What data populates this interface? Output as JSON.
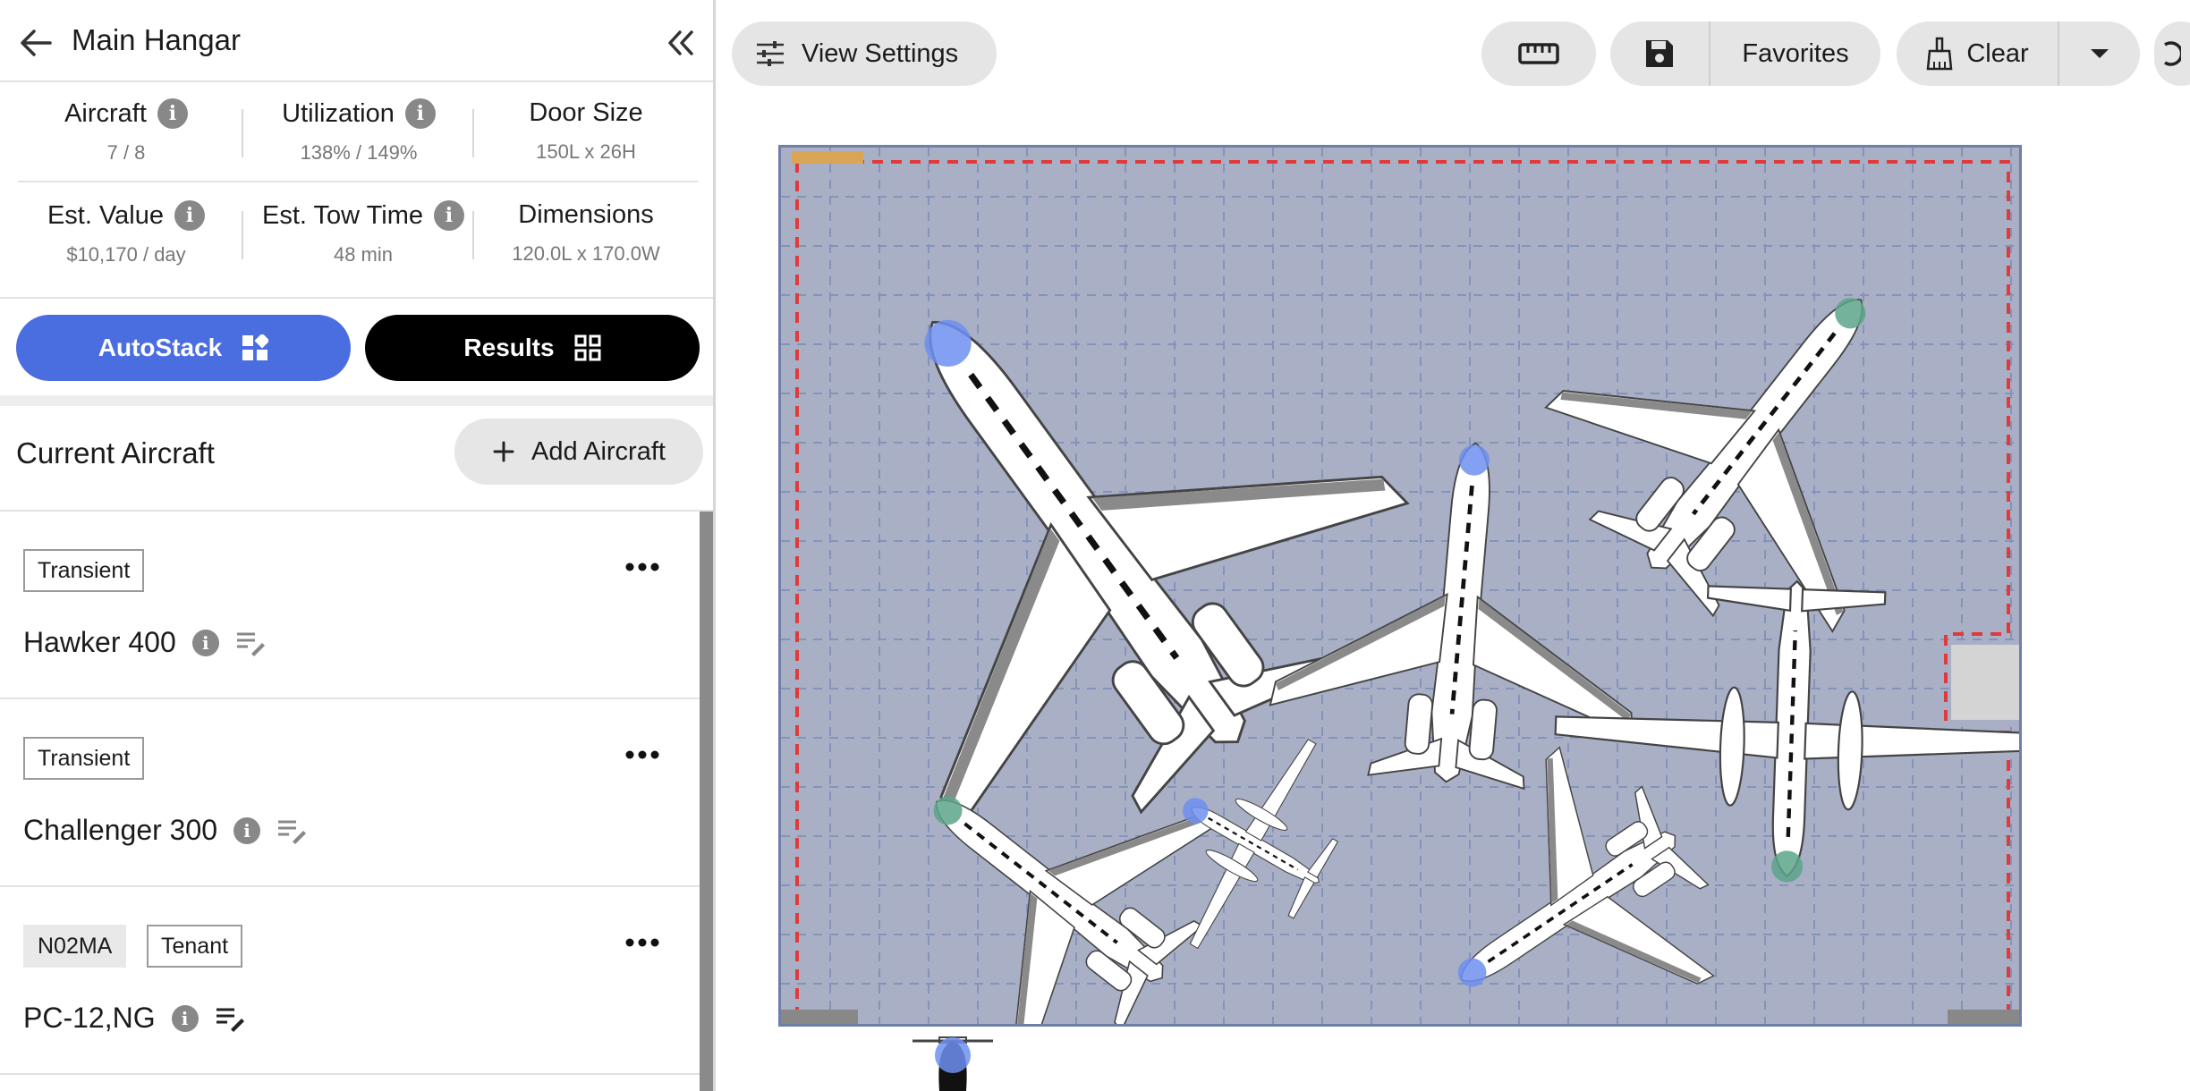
{
  "sidebar": {
    "title": "Main Hangar",
    "stats": {
      "aircraft": {
        "label": "Aircraft",
        "value": "7  / 8"
      },
      "utilization": {
        "label": "Utilization",
        "value": "138%  / 149%"
      },
      "door_size": {
        "label": "Door Size",
        "value": "150L x 26H"
      },
      "est_value": {
        "label": "Est. Value",
        "value": "$10,170 / day"
      },
      "est_tow_time": {
        "label": "Est. Tow Time",
        "value": "48 min"
      },
      "dimensions": {
        "label": "Dimensions",
        "value": "120.0L x 170.0W"
      }
    },
    "autostack_label": "AutoStack",
    "results_label": "Results",
    "current_title": "Current Aircraft",
    "add_aircraft_label": "Add Aircraft",
    "aircraft": [
      {
        "tags": [
          "Transient"
        ],
        "name": "Hawker 400"
      },
      {
        "tags": [
          "Transient"
        ],
        "name": "Challenger 300"
      },
      {
        "registration": "N02MA",
        "tags": [
          "Tenant"
        ],
        "name": "PC-12,NG"
      }
    ]
  },
  "toolbar": {
    "view_settings_label": "View Settings",
    "favorites_label": "Favorites",
    "clear_label": "Clear"
  },
  "colors": {
    "accent": "#4a6ee0",
    "hangar_floor": "#a9b0c6",
    "door_line": "#e03a3a",
    "nose_blue": "#6f8ff0",
    "nose_green": "#5da58a"
  },
  "icons": {
    "back": "arrow-left-icon",
    "collapse": "double-chevron-left-icon",
    "info": "info-icon",
    "notes": "notes-edit-icon",
    "more": "ellipsis-icon",
    "view_settings": "sliders-icon",
    "ruler": "ruler-icon",
    "save": "save-icon",
    "clear": "broom-icon",
    "dropdown": "caret-down-icon"
  }
}
